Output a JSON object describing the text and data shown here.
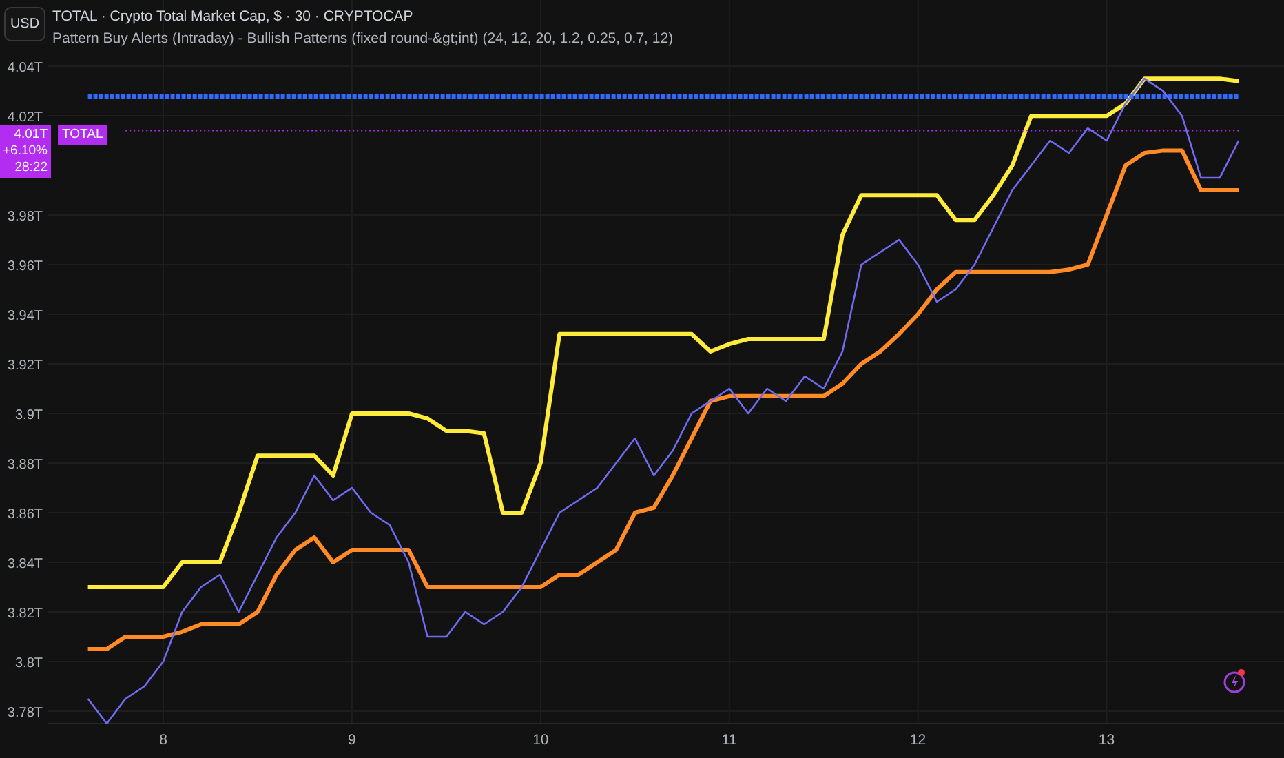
{
  "currency_button": "USD",
  "legend": {
    "title": "TOTAL · Crypto Total Market Cap, $ · 30 · CRYPTOCAP",
    "indicator": "Pattern Buy Alerts (Intraday) - Bullish Patterns (fixed round-&gt;int) (24, 12, 20, 1.2, 0.25, 0.7, 12)"
  },
  "price_label": {
    "value": "4.01T",
    "change": "+6.10%",
    "countdown": "28:22"
  },
  "symbol_label": "TOTAL",
  "chart_data": {
    "type": "line",
    "x": [
      7.6,
      7.7,
      7.8,
      7.9,
      8.0,
      8.1,
      8.2,
      8.3,
      8.4,
      8.5,
      8.6,
      8.7,
      8.8,
      8.9,
      9.0,
      9.1,
      9.2,
      9.3,
      9.4,
      9.5,
      9.6,
      9.7,
      9.8,
      9.9,
      10.0,
      10.1,
      10.2,
      10.3,
      10.4,
      10.5,
      10.6,
      10.7,
      10.8,
      10.9,
      11.0,
      11.1,
      11.2,
      11.3,
      11.4,
      11.5,
      11.6,
      11.7,
      11.8,
      11.9,
      12.0,
      12.1,
      12.2,
      12.3,
      12.4,
      12.5,
      12.6,
      12.7,
      12.8,
      12.9,
      13.0,
      13.1,
      13.2,
      13.3,
      13.4,
      13.5,
      13.6,
      13.7
    ],
    "series": [
      {
        "color": "#ffeb3b",
        "values": [
          3.83,
          3.83,
          3.83,
          3.83,
          3.83,
          3.84,
          3.84,
          3.84,
          3.86,
          3.883,
          3.883,
          3.883,
          3.883,
          3.875,
          3.9,
          3.9,
          3.9,
          3.9,
          3.898,
          3.893,
          3.893,
          3.892,
          3.86,
          3.86,
          3.88,
          3.932,
          3.932,
          3.932,
          3.932,
          3.932,
          3.932,
          3.932,
          3.932,
          3.925,
          3.928,
          3.93,
          3.93,
          3.93,
          3.93,
          3.93,
          3.972,
          3.988,
          3.988,
          3.988,
          3.988,
          3.988,
          3.978,
          3.978,
          3.988,
          4.0,
          4.02,
          4.02,
          4.02,
          4.02,
          4.02,
          4.025,
          4.035,
          4.035,
          4.035,
          4.035,
          4.035,
          4.034
        ]
      },
      {
        "color": "#ff8a26",
        "values": [
          3.805,
          3.805,
          3.81,
          3.81,
          3.81,
          3.812,
          3.815,
          3.815,
          3.815,
          3.82,
          3.835,
          3.845,
          3.85,
          3.84,
          3.845,
          3.845,
          3.845,
          3.845,
          3.83,
          3.83,
          3.83,
          3.83,
          3.83,
          3.83,
          3.83,
          3.835,
          3.835,
          3.84,
          3.845,
          3.86,
          3.862,
          3.875,
          3.89,
          3.905,
          3.907,
          3.907,
          3.907,
          3.907,
          3.907,
          3.907,
          3.912,
          3.92,
          3.925,
          3.932,
          3.94,
          3.95,
          3.957,
          3.957,
          3.957,
          3.957,
          3.957,
          3.957,
          3.958,
          3.96,
          3.98,
          4.0,
          4.005,
          4.006,
          4.006,
          3.99,
          3.99,
          3.99
        ]
      },
      {
        "color": "#2f6bff",
        "line_style": "dense-dotted",
        "values": [
          4.028,
          4.028,
          4.028,
          4.028,
          4.028,
          4.028,
          4.028,
          4.028,
          4.028,
          4.028,
          4.028,
          4.028,
          4.028,
          4.028,
          4.028,
          4.028,
          4.028,
          4.028,
          4.028,
          4.028,
          4.028,
          4.028,
          4.028,
          4.028,
          4.028,
          4.028,
          4.028,
          4.028,
          4.028,
          4.028,
          4.028,
          4.028,
          4.028,
          4.028,
          4.028,
          4.028,
          4.028,
          4.028,
          4.028,
          4.028,
          4.028,
          4.028,
          4.028,
          4.028,
          4.028,
          4.028,
          4.028,
          4.028,
          4.028,
          4.028,
          4.028,
          4.028,
          4.028,
          4.028,
          4.028,
          4.028,
          4.028,
          4.028,
          4.028,
          4.028,
          4.028,
          4.028
        ]
      },
      {
        "color": "#b32df0",
        "line_style": "dotted",
        "values": [
          null,
          null,
          4.014,
          4.014,
          4.014,
          4.014,
          4.014,
          4.014,
          4.014,
          4.014,
          4.014,
          4.014,
          4.014,
          4.014,
          4.014,
          4.014,
          4.014,
          4.014,
          4.014,
          4.014,
          4.014,
          4.014,
          4.014,
          4.014,
          4.014,
          4.014,
          4.014,
          4.014,
          4.014,
          4.014,
          4.014,
          4.014,
          4.014,
          4.014,
          4.014,
          4.014,
          4.014,
          4.014,
          4.014,
          4.014,
          4.014,
          4.014,
          4.014,
          4.014,
          4.014,
          4.014,
          4.014,
          4.014,
          4.014,
          4.014,
          4.014,
          4.014,
          4.014,
          4.014,
          4.014,
          4.014,
          4.014,
          4.014,
          4.014,
          4.014,
          4.014,
          4.014
        ]
      },
      {
        "color": "#6f6cf2",
        "values": [
          3.785,
          3.775,
          3.785,
          3.79,
          3.8,
          3.82,
          3.83,
          3.835,
          3.82,
          3.835,
          3.85,
          3.86,
          3.875,
          3.865,
          3.87,
          3.86,
          3.855,
          3.84,
          3.81,
          3.81,
          3.82,
          3.815,
          3.82,
          3.83,
          3.845,
          3.86,
          3.865,
          3.87,
          3.88,
          3.89,
          3.875,
          3.885,
          3.9,
          3.905,
          3.91,
          3.9,
          3.91,
          3.905,
          3.915,
          3.91,
          3.925,
          3.96,
          3.965,
          3.97,
          3.96,
          3.945,
          3.95,
          3.96,
          3.975,
          3.99,
          4.0,
          4.01,
          4.005,
          4.015,
          4.01,
          4.025,
          4.035,
          4.03,
          4.02,
          3.995,
          3.995,
          4.01
        ]
      }
    ],
    "xlim": [
      7.39,
      13.94
    ],
    "ylim": [
      3.775,
      4.0667
    ],
    "xticks": [
      8,
      9,
      10,
      11,
      12,
      13
    ],
    "yticks": [
      {
        "value": 3.78,
        "label": "3.78T"
      },
      {
        "value": 3.8,
        "label": "3.8T"
      },
      {
        "value": 3.82,
        "label": "3.82T"
      },
      {
        "value": 3.84,
        "label": "3.84T"
      },
      {
        "value": 3.86,
        "label": "3.86T"
      },
      {
        "value": 3.88,
        "label": "3.88T"
      },
      {
        "value": 3.9,
        "label": "3.9T"
      },
      {
        "value": 3.92,
        "label": "3.92T"
      },
      {
        "value": 3.94,
        "label": "3.94T"
      },
      {
        "value": 3.96,
        "label": "3.96T"
      },
      {
        "value": 3.98,
        "label": "3.98T"
      },
      {
        "value": 4.02,
        "label": "4.02T"
      },
      {
        "value": 4.04,
        "label": "4.04T"
      }
    ],
    "grid": true
  }
}
